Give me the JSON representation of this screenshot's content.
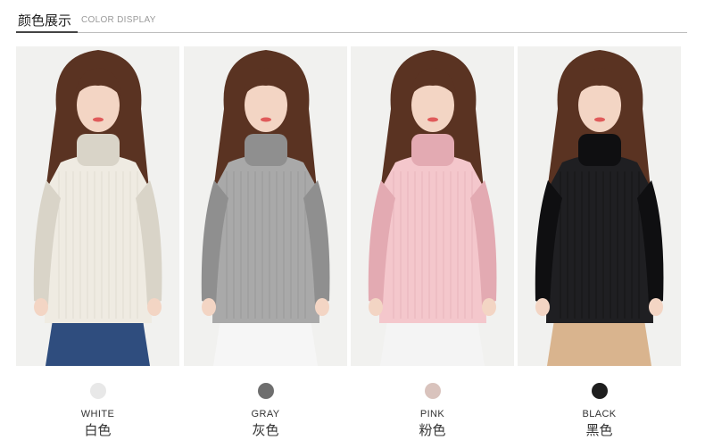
{
  "header": {
    "title_cn": "颜色展示",
    "title_en": "COLOR DISPLAY"
  },
  "colors": [
    {
      "name_en": "WHITE",
      "name_cn": "白色",
      "swatch": "#e8e8e8",
      "sweater": "#efebe2",
      "sweater_shadow": "#d9d4c8",
      "bottom": "#2f4d7e"
    },
    {
      "name_en": "GRAY",
      "name_cn": "灰色",
      "swatch": "#6e6e6e",
      "sweater": "#a9a9a9",
      "sweater_shadow": "#8f8f8f",
      "bottom": "#f6f6f6"
    },
    {
      "name_en": "PINK",
      "name_cn": "粉色",
      "swatch": "#d9c3bd",
      "sweater": "#f4c7cc",
      "sweater_shadow": "#e3aab2",
      "bottom": "#f4f4f4"
    },
    {
      "name_en": "BLACK",
      "name_cn": "黑色",
      "swatch": "#1e1e1e",
      "sweater": "#1f1f22",
      "sweater_shadow": "#0f0f11",
      "bottom": "#d9b48e"
    }
  ]
}
